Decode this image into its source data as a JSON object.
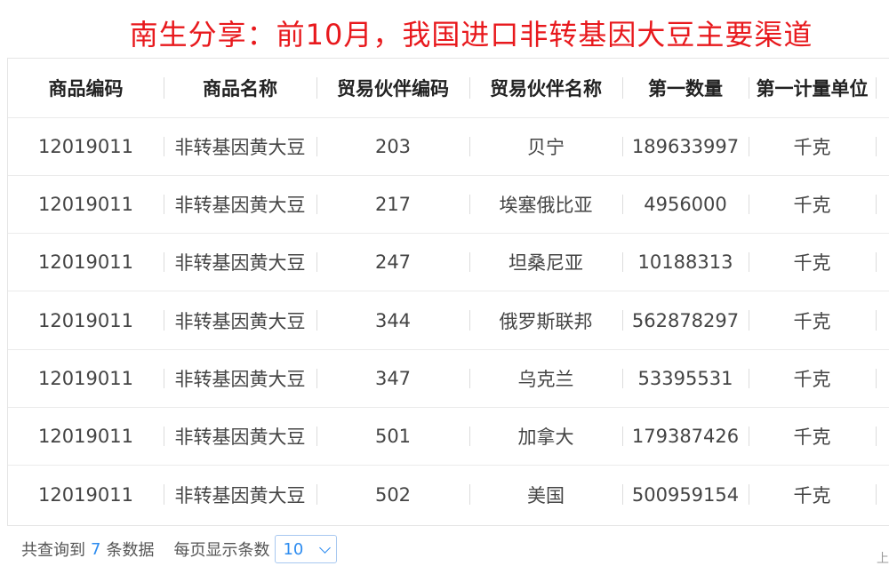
{
  "title": "南生分享：前10月，我国进口非转基因大豆主要渠道",
  "table": {
    "headers": [
      "商品编码",
      "商品名称",
      "贸易伙伴编码",
      "贸易伙伴名称",
      "第一数量",
      "第一计量单位"
    ],
    "rows": [
      [
        "12019011",
        "非转基因黄大豆",
        "203",
        "贝宁",
        "189633997",
        "千克"
      ],
      [
        "12019011",
        "非转基因黄大豆",
        "217",
        "埃塞俄比亚",
        "4956000",
        "千克"
      ],
      [
        "12019011",
        "非转基因黄大豆",
        "247",
        "坦桑尼亚",
        "10188313",
        "千克"
      ],
      [
        "12019011",
        "非转基因黄大豆",
        "344",
        "俄罗斯联邦",
        "562878297",
        "千克"
      ],
      [
        "12019011",
        "非转基因黄大豆",
        "347",
        "乌克兰",
        "53395531",
        "千克"
      ],
      [
        "12019011",
        "非转基因黄大豆",
        "501",
        "加拿大",
        "179387426",
        "千克"
      ],
      [
        "12019011",
        "非转基因黄大豆",
        "502",
        "美国",
        "500959154",
        "千克"
      ]
    ]
  },
  "footer": {
    "total_prefix": "共查询到",
    "total_count": "7",
    "total_suffix": "条数据",
    "page_size_label": "每页显示条数",
    "page_size_value": "10",
    "edge_text": "上"
  },
  "colors": {
    "title": "#e8191d",
    "accent": "#2d8cf0"
  }
}
